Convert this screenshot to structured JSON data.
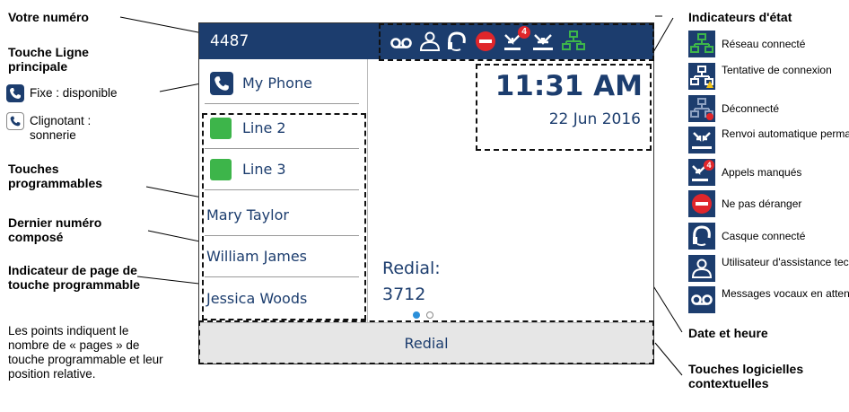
{
  "phone": {
    "number": "4487",
    "time": "11:31 AM",
    "date": "22 Jun 2016",
    "redial_label": "Redial:",
    "redial_number": "3712",
    "softkey": "Redial",
    "line_keys": [
      {
        "label": "My Phone",
        "icon": "phone-icon"
      },
      {
        "label": "Line 2",
        "icon": "green-line-icon"
      },
      {
        "label": "Line 3",
        "icon": "green-line-icon"
      },
      {
        "label": "Mary Taylor"
      },
      {
        "label": "William James"
      },
      {
        "label": "Jessica Woods"
      }
    ],
    "status_icons": [
      "voicemail-icon",
      "tech-support-user-icon",
      "headset-icon",
      "do-not-disturb-icon",
      "missed-calls-icon",
      "call-forward-icon",
      "network-connected-icon"
    ],
    "missed_calls_badge": "4",
    "page_indicator": {
      "pages": 2,
      "current": 1
    },
    "colors": {
      "header": "#1c3d6e",
      "accent_green": "#3db54a",
      "dnd_red": "#e0262b",
      "badge_red": "#e0262b",
      "page_dot_active": "#2b8fd9"
    }
  },
  "annotations": {
    "your_number": "Votre numéro",
    "main_line_key_title": "Touche Ligne principale",
    "fixed_available": "Fixe : disponible",
    "blinking_ringing": "Clignotant : sonnerie",
    "programmable_keys": "Touches programmables",
    "last_dialed": "Dernier numéro composé",
    "page_indicator_title": "Indicateur de page de touche programmable",
    "page_indicator_desc": "Les points indiquent le nombre de « pages » de touche programmable et leur position relative.",
    "status_indicators": "Indicateurs d'état",
    "date_time": "Date et heure",
    "context_softkeys": "Touches logicielles contextuelles"
  },
  "legend": [
    {
      "icon": "network-connected-icon",
      "label": "Réseau connecté"
    },
    {
      "icon": "connection-attempt-icon",
      "label": "Tentative de connexion"
    },
    {
      "icon": "disconnected-icon",
      "label": "Déconnecté"
    },
    {
      "icon": "call-forward-icon",
      "label": "Renvoi automatique permanent"
    },
    {
      "icon": "missed-calls-icon",
      "label": "Appels manqués",
      "badge": "4"
    },
    {
      "icon": "do-not-disturb-icon",
      "label": "Ne pas déranger"
    },
    {
      "icon": "headset-icon",
      "label": "Casque connecté"
    },
    {
      "icon": "tech-support-user-icon",
      "label": "Utilisateur d'assistance technique"
    },
    {
      "icon": "voicemail-icon",
      "label": "Messages vocaux en attente"
    }
  ]
}
